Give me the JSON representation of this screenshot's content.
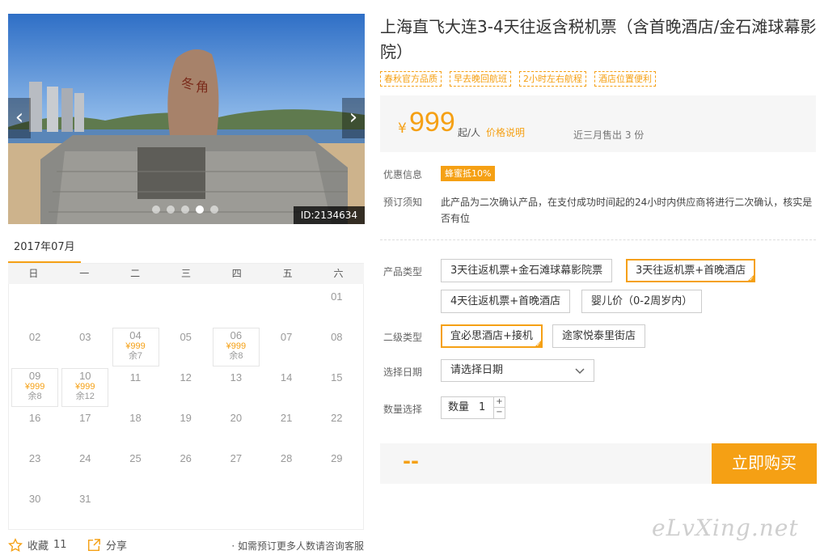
{
  "gallery": {
    "prev_arrow": "‹",
    "next_arrow": "›",
    "image_id": "ID:2134634",
    "slide_count": 5,
    "active_slide": 4
  },
  "calendar": {
    "month": "2017年07月",
    "weekdays": [
      "日",
      "一",
      "二",
      "三",
      "四",
      "五",
      "六"
    ],
    "days": [
      {
        "d": "01"
      },
      {
        "d": "02"
      },
      {
        "d": "03"
      },
      {
        "d": "04",
        "price": "¥999",
        "remain": "余7"
      },
      {
        "d": "05"
      },
      {
        "d": "06",
        "price": "¥999",
        "remain": "余8"
      },
      {
        "d": "07"
      },
      {
        "d": "08"
      },
      {
        "d": "09",
        "price": "¥999",
        "remain": "余8"
      },
      {
        "d": "10",
        "price": "¥999",
        "remain": "余12"
      },
      {
        "d": "11"
      },
      {
        "d": "12"
      },
      {
        "d": "13"
      },
      {
        "d": "14"
      },
      {
        "d": "15"
      },
      {
        "d": "16"
      },
      {
        "d": "17"
      },
      {
        "d": "18"
      },
      {
        "d": "19"
      },
      {
        "d": "20"
      },
      {
        "d": "21"
      },
      {
        "d": "22"
      },
      {
        "d": "23"
      },
      {
        "d": "24"
      },
      {
        "d": "25"
      },
      {
        "d": "26"
      },
      {
        "d": "27"
      },
      {
        "d": "28"
      },
      {
        "d": "29"
      },
      {
        "d": "30"
      },
      {
        "d": "31"
      }
    ],
    "first_weekday": 6
  },
  "footer": {
    "favorite_label": "收藏",
    "favorite_count": "11",
    "share_label": "分享",
    "consult_text": "· 如需预订更多人数请咨询客服"
  },
  "product": {
    "title": "上海直飞大连3-4天往返含税机票（含首晚酒店/金石滩球幕影院）",
    "tags": [
      "春秋官方品质",
      "早去晚回航班",
      "2小时左右航程",
      "酒店位置便利"
    ],
    "price": {
      "currency": "¥",
      "value": "999",
      "unit": "起/人",
      "explain": "价格说明",
      "sold": "近三月售出 3 份"
    },
    "promo_label": "优惠信息",
    "promo_badge": "蜂蜜抵10%",
    "notice_label": "预订须知",
    "notice_text": "此产品为二次确认产品，在支付成功时间起的24小时内供应商将进行二次确认，核实是否有位",
    "type_label": "产品类型",
    "types": [
      "3天往返机票+金石滩球幕影院票",
      "3天往返机票+首晚酒店",
      "4天往返机票+首晚酒店",
      "婴儿价（0-2周岁内）"
    ],
    "selected_type": "3天往返机票+首晚酒店",
    "subtype_label": "二级类型",
    "subtypes": [
      "宜必思酒店+接机",
      "途家悦泰里街店"
    ],
    "selected_subtype": "宜必思酒店+接机",
    "date_label": "选择日期",
    "date_placeholder": "请选择日期",
    "qty_label": "数量选择",
    "qty_inner_label": "数量",
    "qty_value": "1",
    "qty_plus": "+",
    "qty_minus": "−",
    "total": "--",
    "buy_label": "立即购买"
  },
  "watermark": "eLvXing.net",
  "colors": {
    "accent": "#f5a014",
    "panel_bg": "#f6f6f6",
    "text": "#333333"
  }
}
